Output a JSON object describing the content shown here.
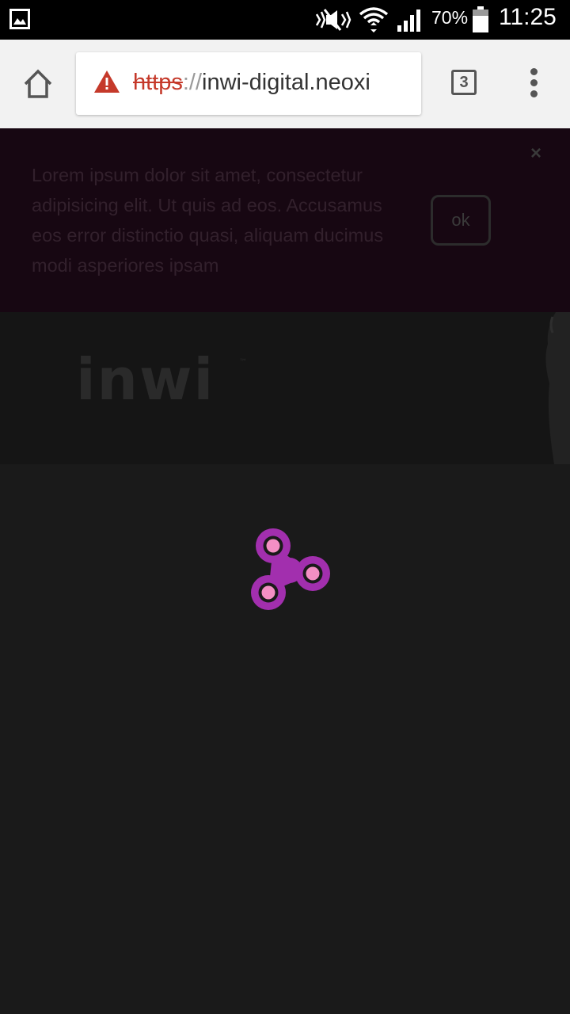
{
  "status_bar": {
    "battery_percent": "70%",
    "time": "11:25",
    "icons": [
      "gallery-icon",
      "mute-icon",
      "wifi-icon",
      "signal-icon",
      "battery-icon"
    ]
  },
  "browser": {
    "url_scheme": "https",
    "url_separator": "://",
    "url_host": "inwi-digital.neoxi",
    "tab_count": "3",
    "icons": [
      "home-icon",
      "warning-icon",
      "tabs-icon",
      "overflow-menu-icon"
    ]
  },
  "banner": {
    "text": "Lorem ipsum dolor sit amet, consectetur adipisicing elit. Ut quis ad eos. Accusamus eos error distinctio quasi, aliquam ducimus modi asperiores ipsam",
    "ok_label": "ok",
    "close_label": "×"
  },
  "hero": {
    "logo_text": "inwi"
  },
  "colors": {
    "spinner_primary": "#a22fae",
    "spinner_accent": "#f48fc4",
    "banner_bg": "#170712",
    "page_bg": "#1a1a1a",
    "warning_red": "#c5392a"
  }
}
